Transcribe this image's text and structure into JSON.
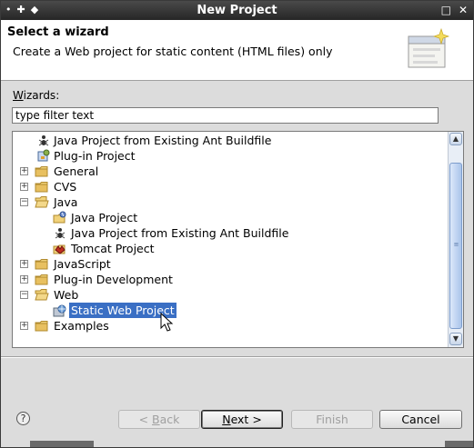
{
  "window": {
    "title": "New Project",
    "title_left_icons": [
      "•",
      "✚",
      "◆"
    ],
    "title_right_icons": [
      "□",
      "✕"
    ]
  },
  "banner": {
    "title": "Select a wizard",
    "description": "Create a Web project for static content (HTML files) only"
  },
  "wizards": {
    "label_accel": "W",
    "label_rest": "izards:",
    "filter_placeholder": "type filter text"
  },
  "tree": {
    "items": [
      {
        "label": "Java Project from Existing Ant Buildfile",
        "level": 1,
        "icon": "ant-icon",
        "expander": "none"
      },
      {
        "label": "Plug-in Project",
        "level": 1,
        "icon": "plugin-project-icon",
        "expander": "none"
      },
      {
        "label": "General",
        "level": 0,
        "icon": "folder-icon",
        "expander": "+"
      },
      {
        "label": "CVS",
        "level": 0,
        "icon": "folder-icon",
        "expander": "+"
      },
      {
        "label": "Java",
        "level": 0,
        "icon": "folder-open-icon",
        "expander": "-"
      },
      {
        "label": "Java Project",
        "level": 2,
        "icon": "java-project-icon",
        "expander": "none"
      },
      {
        "label": "Java Project from Existing Ant Buildfile",
        "level": 2,
        "icon": "ant-icon",
        "expander": "none"
      },
      {
        "label": "Tomcat Project",
        "level": 2,
        "icon": "tomcat-icon",
        "expander": "none"
      },
      {
        "label": "JavaScript",
        "level": 0,
        "icon": "folder-icon",
        "expander": "+"
      },
      {
        "label": "Plug-in Development",
        "level": 0,
        "icon": "folder-icon",
        "expander": "+"
      },
      {
        "label": "Web",
        "level": 0,
        "icon": "folder-open-icon",
        "expander": "-"
      },
      {
        "label": "Static Web Project",
        "level": 2,
        "icon": "web-project-icon",
        "expander": "none",
        "selected": true
      },
      {
        "label": "Examples",
        "level": 0,
        "icon": "folder-icon",
        "expander": "+"
      }
    ]
  },
  "footer": {
    "help_label": "?",
    "back": {
      "accel": "B",
      "rest": "ack",
      "prefix": "< "
    },
    "next": {
      "accel": "N",
      "rest": "ext",
      "suffix": " >"
    },
    "finish_label": "Finish",
    "cancel_label": "Cancel"
  },
  "colors": {
    "selection": "#3a6fc4",
    "titlebar": "#2f2f2f",
    "folder": "#e8c060"
  }
}
